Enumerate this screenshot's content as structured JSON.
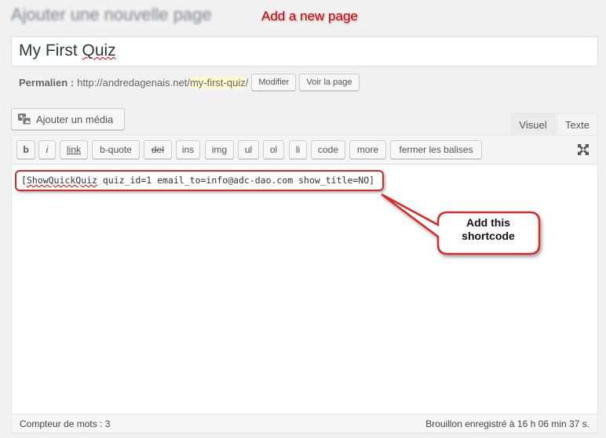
{
  "header": {
    "page_heading": "Ajouter une nouvelle page",
    "annotation_title": "Add a new page"
  },
  "title_field": {
    "value_prefix": "My First ",
    "value_misspelled": "Quiz"
  },
  "permalink": {
    "label": "Permalien :",
    "base_url": "http://andredagenais.net/",
    "slug": "my-first-quiz",
    "trailing": "/",
    "edit_button": "Modifier",
    "view_button": "Voir la page"
  },
  "media": {
    "button_label": "Ajouter un média",
    "icon": "media-icon"
  },
  "editor_tabs": [
    {
      "label": "Visuel"
    },
    {
      "label": "Texte",
      "active": true
    }
  ],
  "quicktags": [
    {
      "label": "b"
    },
    {
      "label": "i"
    },
    {
      "label": "link"
    },
    {
      "label": "b-quote"
    },
    {
      "label": "del"
    },
    {
      "label": "ins"
    },
    {
      "label": "img"
    },
    {
      "label": "ul"
    },
    {
      "label": "ol"
    },
    {
      "label": "li"
    },
    {
      "label": "code"
    },
    {
      "label": "more"
    },
    {
      "label": "fermer les balises"
    }
  ],
  "editor": {
    "content_open": "[",
    "content_misspelled": "ShowQuickQuiz",
    "content_rest": " quiz_id=1 email_to=info@adc-dao.com show_title=NO]",
    "fullscreen_icon": "fullscreen-icon"
  },
  "callout": {
    "text_line1": "Add this",
    "text_line2": "shortcode",
    "color": "#d42a2a"
  },
  "statusbar": {
    "word_count": "Compteur de mots : 3",
    "draft_saved": "Brouillon enregistré à 16 h 06 min 37 s."
  }
}
